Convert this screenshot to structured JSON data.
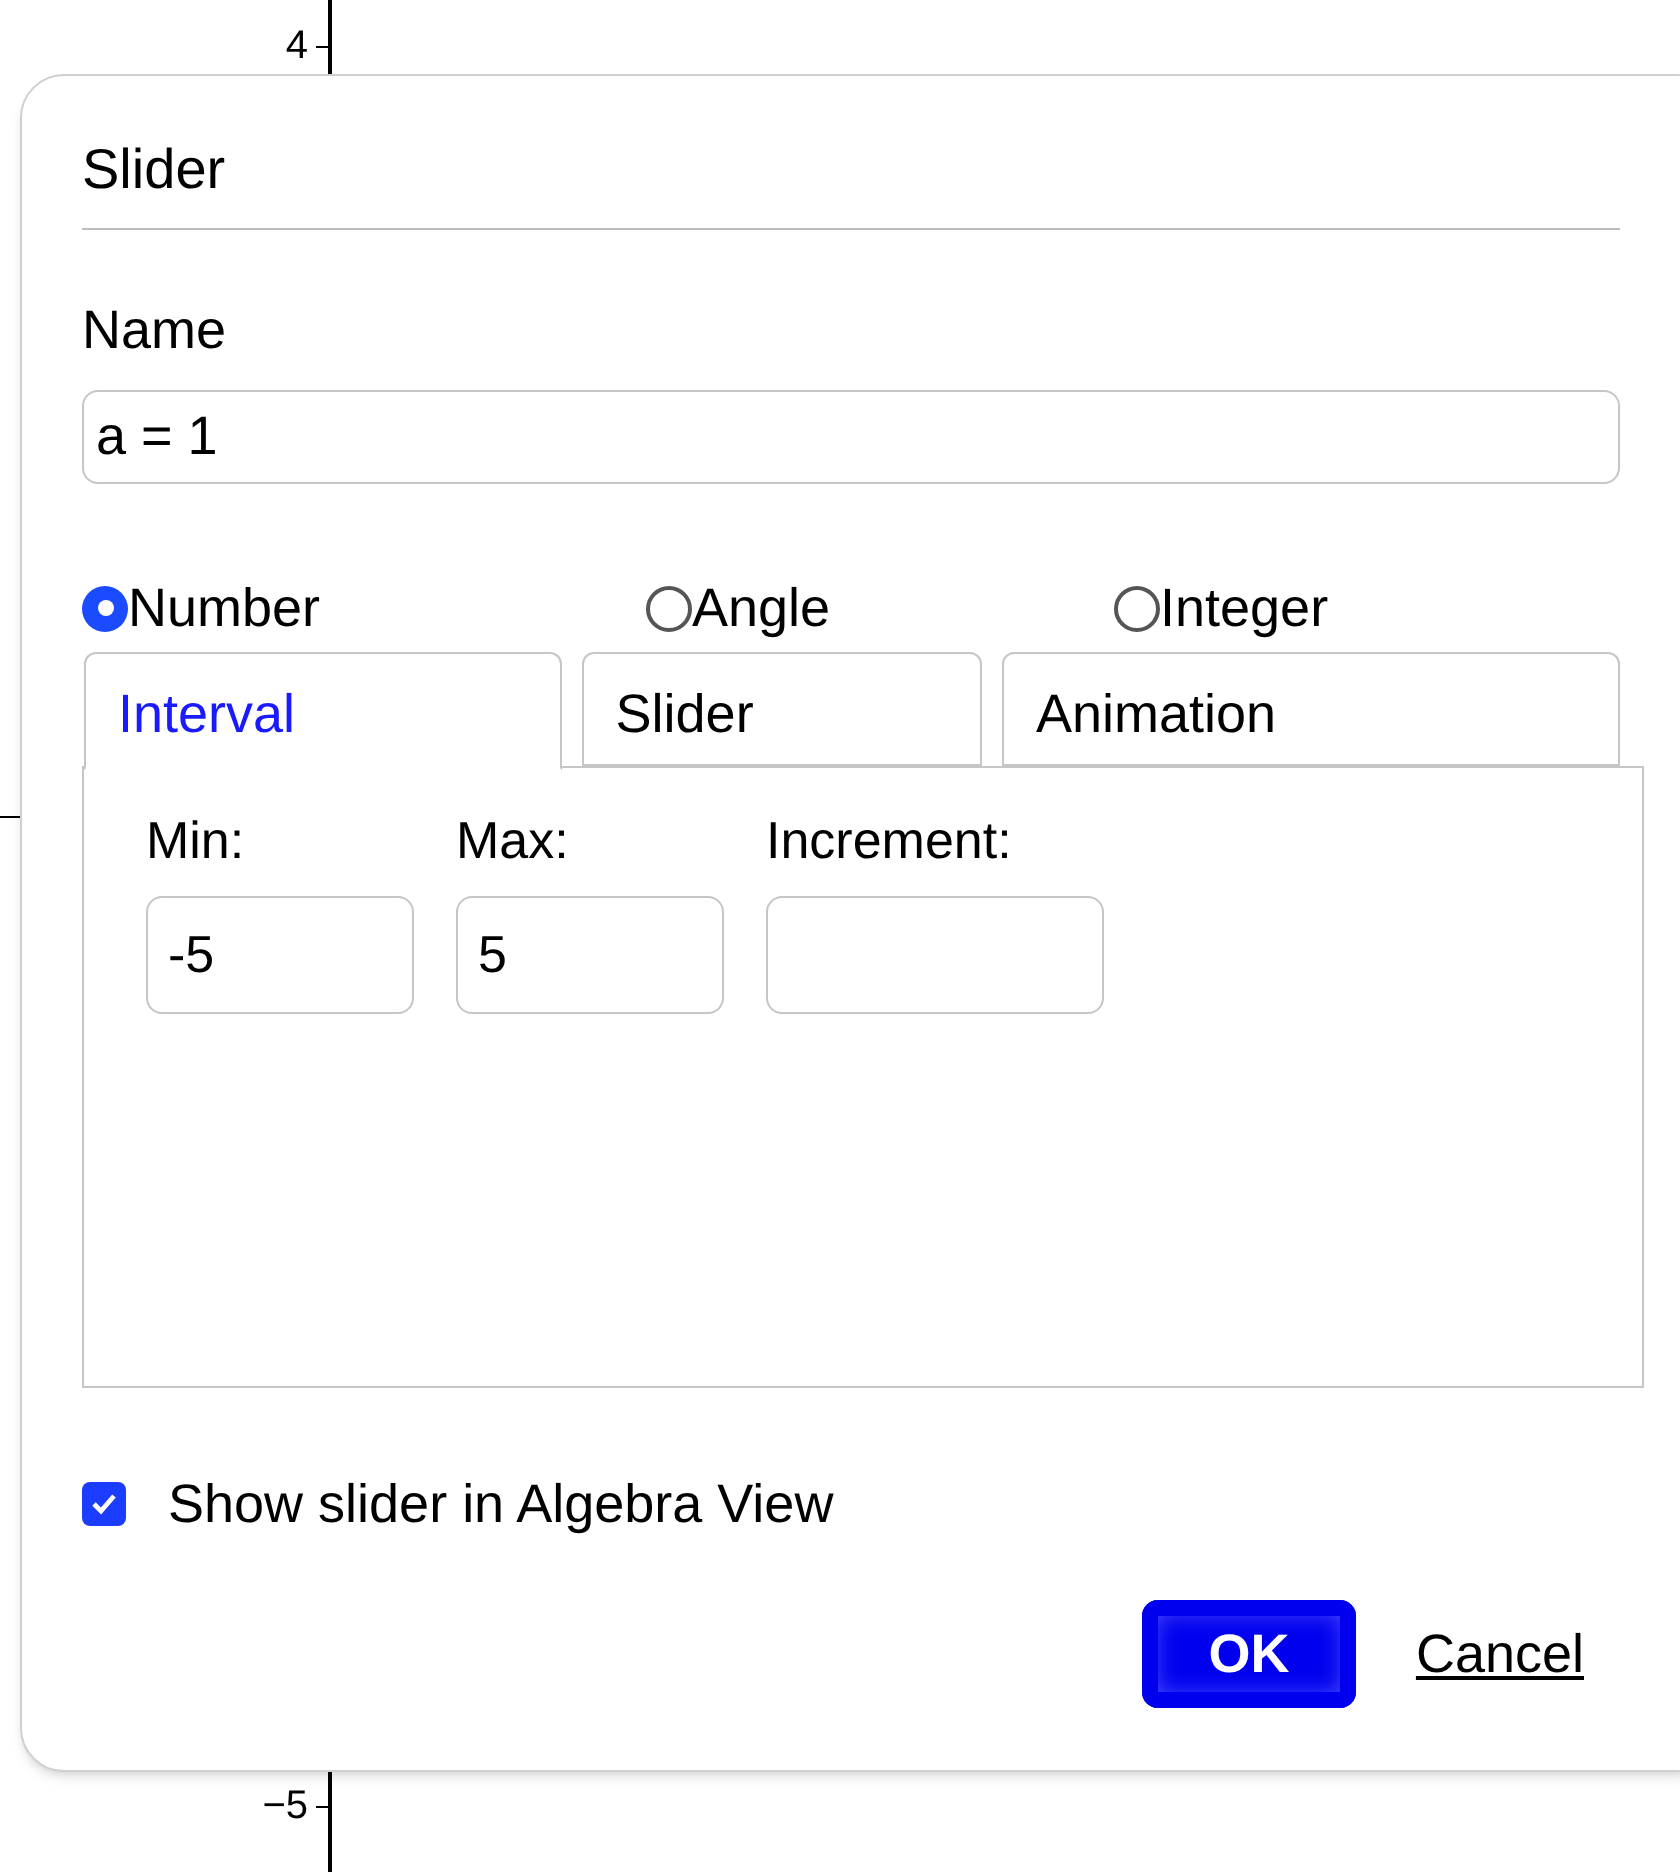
{
  "graph": {
    "tick_labels": [
      {
        "label": "4"
      },
      {
        "label": "−5"
      }
    ]
  },
  "dialog": {
    "title": "Slider",
    "name_label": "Name",
    "name_value": "a = 1",
    "types": [
      {
        "label": "Number",
        "selected": true
      },
      {
        "label": "Angle",
        "selected": false
      },
      {
        "label": "Integer",
        "selected": false
      }
    ],
    "tabs": [
      {
        "label": "Interval",
        "selected": true
      },
      {
        "label": "Slider",
        "selected": false
      },
      {
        "label": "Animation",
        "selected": false
      }
    ],
    "fields": [
      {
        "label": "Min:",
        "value": "-5"
      },
      {
        "label": "Max:",
        "value": "5"
      },
      {
        "label": "Increment:"
      }
    ],
    "show_in_algebra": {
      "label": "Show slider in Algebra View",
      "checked": true
    },
    "buttons": [
      {
        "label": "OK",
        "kind": "primary"
      },
      {
        "label": "Cancel",
        "kind": "link"
      }
    ]
  }
}
